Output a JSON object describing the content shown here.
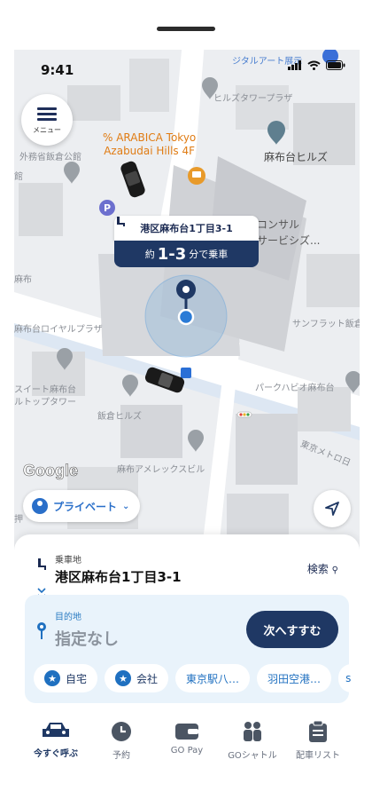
{
  "status": {
    "time": "9:41"
  },
  "menu": {
    "label": "メニュー"
  },
  "map": {
    "labels": {
      "top_promo": "ジタルアート展示",
      "hills_tower": "ヒルズタワープラザ",
      "gaimusho": "外務省飯倉公館",
      "kan": "館",
      "consul": "コンサル",
      "consul2": "サービシズ...",
      "azabudai_royal": "麻布台ロイヤルプラザ",
      "sunflat": "サンフラット飯倉",
      "suite": "スイート麻布台",
      "rutop": "ルトップタワー",
      "iikura_hills": "飯倉ヒルズ",
      "park_habio": "パークハビオ麻布台",
      "america": "麻布アメレックスビル",
      "metro": "東京メトロ日",
      "asabu": "麻布",
      "oshi": "押"
    },
    "poi_arabica": "% ARABICA Tokyo\nAzabudai Hills 4F",
    "poi_arabica_1": "% ARABICA Tokyo",
    "poi_arabica_2": "Azabudai Hills 4F",
    "poi_hills": "麻布台ヒルズ",
    "google": "Google"
  },
  "pickup_popup": {
    "address": "港区麻布台1丁目3-1",
    "eta_prefix": "約",
    "eta_value": "1-3",
    "eta_suffix": "分で乗車"
  },
  "private_button": {
    "label": "プライベート"
  },
  "sheet": {
    "pickup_caption": "乗車地",
    "pickup_address": "港区麻布台1丁目3-1",
    "search_link": "検索",
    "dest_caption": "目的地",
    "dest_value": "指定なし",
    "next_button": "次へすすむ",
    "chips": [
      "自宅",
      "会社",
      "東京駅八…",
      "羽田空港…",
      "s"
    ]
  },
  "tabs": [
    {
      "label": "今すぐ呼ぶ",
      "icon": "car-icon",
      "active": true
    },
    {
      "label": "予約",
      "icon": "clock-icon"
    },
    {
      "label": "GO Pay",
      "icon": "wallet-icon"
    },
    {
      "label": "GOシャトル",
      "icon": "people-icon"
    },
    {
      "label": "配車リスト",
      "icon": "clipboard-icon"
    }
  ],
  "colors": {
    "navy": "#1f3864",
    "blue": "#2a6fc9",
    "orange": "#e07c14",
    "dest_bg": "#e9f3fb"
  }
}
